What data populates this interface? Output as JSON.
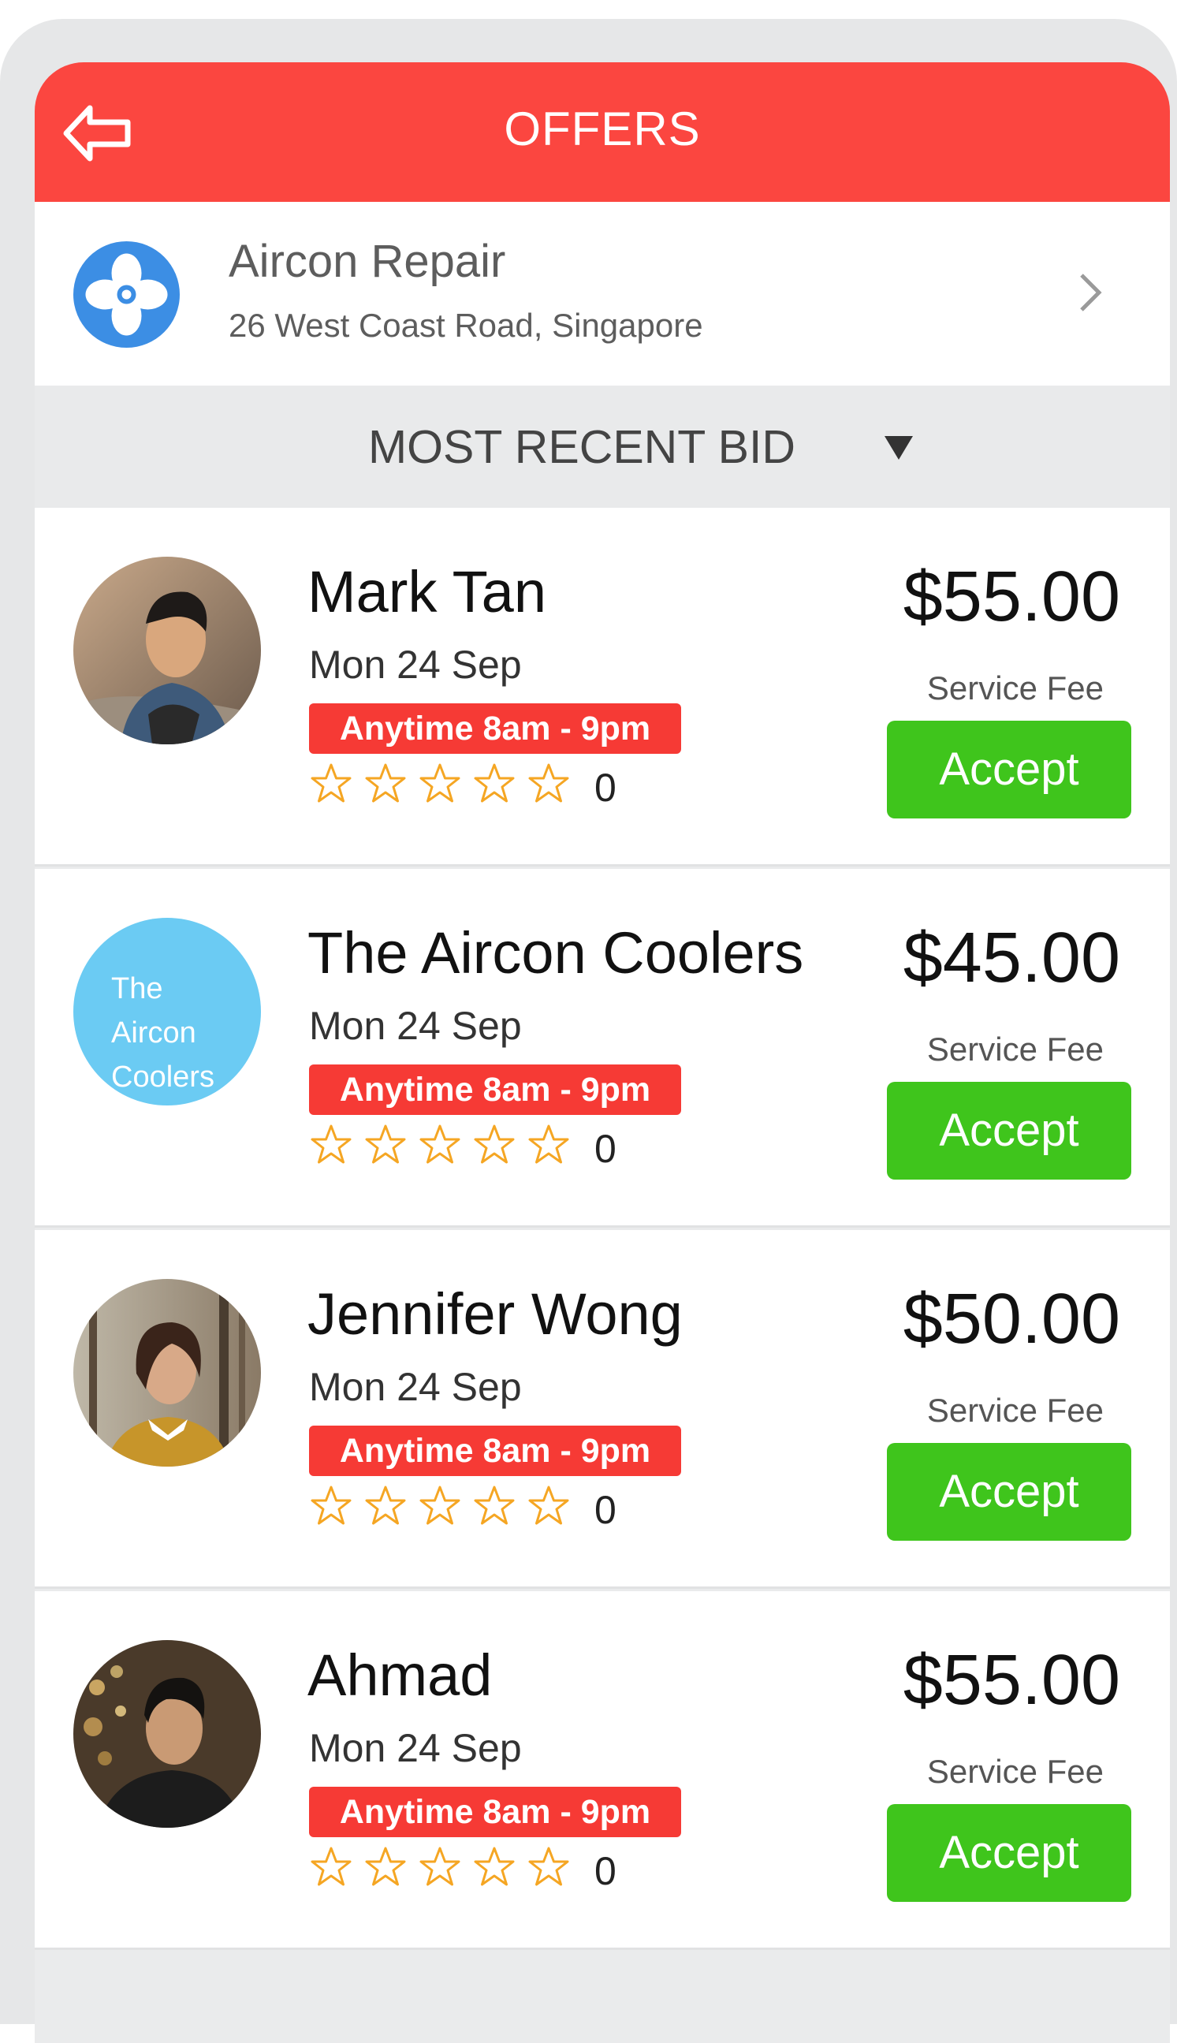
{
  "header": {
    "title": "OFFERS",
    "back_icon": "back-arrow-icon",
    "background_color": "#fb4640"
  },
  "job": {
    "title": "Aircon Repair",
    "address": "26 West Coast Road, Singapore",
    "icon": "fan-icon",
    "icon_color": "#3c8ee4"
  },
  "sort": {
    "label": "MOST RECENT BID",
    "icon": "triangle-down-icon"
  },
  "offers": [
    {
      "name": "Mark Tan",
      "date": "Mon 24 Sep",
      "time": "Anytime 8am - 9pm",
      "rating": "0",
      "price": "$55.00",
      "fee_label": "Service Fee",
      "accept_label": "Accept",
      "avatar": "photo"
    },
    {
      "name": "The Aircon Coolers",
      "date": "Mon 24 Sep",
      "time": "Anytime 8am - 9pm",
      "rating": "0",
      "price": "$45.00",
      "fee_label": "Service Fee",
      "accept_label": "Accept",
      "avatar_text_1": "The",
      "avatar_text_2": "Aircon",
      "avatar_text_3": "Coolers",
      "avatar_color": "#6bcbf3"
    },
    {
      "name": "Jennifer Wong",
      "date": "Mon 24 Sep",
      "time": "Anytime 8am - 9pm",
      "rating": "0",
      "price": "$50.00",
      "fee_label": "Service Fee",
      "accept_label": "Accept",
      "avatar": "photo"
    },
    {
      "name": "Ahmad",
      "date": "Mon 24 Sep",
      "time": "Anytime 8am - 9pm",
      "rating": "0",
      "price": "$55.00",
      "fee_label": "Service Fee",
      "accept_label": "Accept",
      "avatar": "photo"
    }
  ],
  "colors": {
    "accept": "#3fc51c",
    "badge": "#f63a35",
    "star": "#f5a623"
  }
}
